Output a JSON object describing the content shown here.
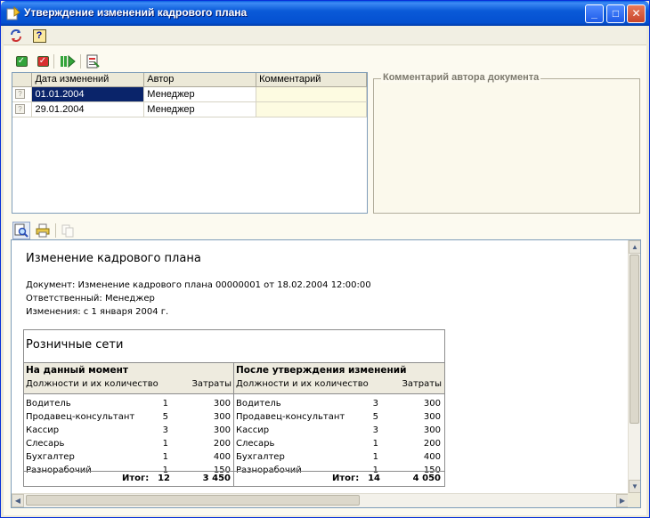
{
  "window": {
    "title": "Утверждение изменений кадрового плана",
    "controls": {
      "minimize": "_",
      "maximize": "□",
      "close": "✕"
    }
  },
  "toolbar_top": {
    "help_label": "?"
  },
  "changes_list": {
    "columns": [
      "Дата изменений",
      "Автор",
      "Комментарий"
    ],
    "rows": [
      {
        "date": "01.01.2004",
        "author": "Менеджер",
        "comment": ""
      },
      {
        "date": "29.01.2004",
        "author": "Менеджер",
        "comment": ""
      }
    ]
  },
  "author_comment": {
    "legend": "Комментарий автора документа",
    "text": ""
  },
  "report": {
    "title": "Изменение кадрового плана",
    "doc_line": "Документ: Изменение кадрового плана 00000001 от 18.02.2004 12:00:00",
    "resp_line": "Ответственный: Менеджер",
    "changes_line": "Изменения: с 1 января 2004 г.",
    "section": "Розничные сети",
    "left": {
      "header": "На данный момент",
      "col_pos": "Должности и их количество",
      "col_cost": "Затраты",
      "rows": [
        {
          "name": "Водитель",
          "qty": "1",
          "cost": "300"
        },
        {
          "name": "Продавец-консультант",
          "qty": "5",
          "cost": "300"
        },
        {
          "name": "Кассир",
          "qty": "3",
          "cost": "300"
        },
        {
          "name": "Слесарь",
          "qty": "1",
          "cost": "200"
        },
        {
          "name": "Бухгалтер",
          "qty": "1",
          "cost": "400"
        },
        {
          "name": "Разнорабочий",
          "qty": "1",
          "cost": "150"
        }
      ],
      "total_label": "Итог:",
      "total_qty": "12",
      "total_cost": "3 450"
    },
    "right": {
      "header": "После утверждения изменений",
      "col_pos": "Должности и их количество",
      "col_cost": "Затраты",
      "rows": [
        {
          "name": "Водитель",
          "qty": "3",
          "cost": "300"
        },
        {
          "name": "Продавец-консультант",
          "qty": "5",
          "cost": "300"
        },
        {
          "name": "Кассир",
          "qty": "3",
          "cost": "300"
        },
        {
          "name": "Слесарь",
          "qty": "1",
          "cost": "200"
        },
        {
          "name": "Бухгалтер",
          "qty": "1",
          "cost": "400"
        },
        {
          "name": "Разнорабочий",
          "qty": "1",
          "cost": "150"
        }
      ],
      "total_label": "Итог:",
      "total_qty": "14",
      "total_cost": "4 050"
    }
  }
}
